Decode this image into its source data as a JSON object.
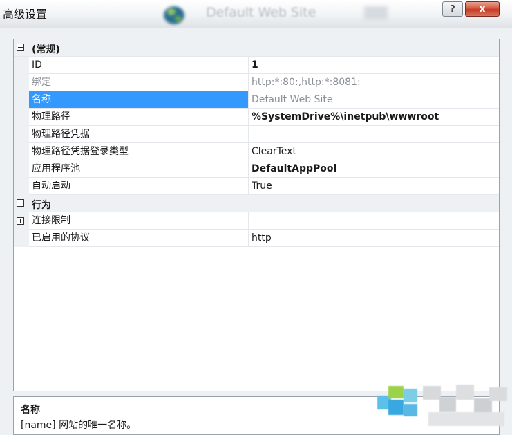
{
  "window": {
    "title": "高级设置",
    "site_name": "Default Web Site",
    "help_label": "?",
    "close_label": "x"
  },
  "categories": [
    {
      "label": "(常规)",
      "expanded": true
    },
    {
      "label": "行为",
      "expanded": true
    }
  ],
  "properties": {
    "general": [
      {
        "name": "ID",
        "value": "1",
        "bold": true
      },
      {
        "name": "绑定",
        "value": "http:*:80:,http:*:8081:",
        "disabled": true
      },
      {
        "name": "名称",
        "value": "Default Web Site",
        "selected": true
      },
      {
        "name": "物理路径",
        "value": "%SystemDrive%\\inetpub\\wwwroot",
        "bold": true
      },
      {
        "name": "物理路径凭据",
        "value": ""
      },
      {
        "name": "物理路径凭据登录类型",
        "value": "ClearText"
      },
      {
        "name": "应用程序池",
        "value": "DefaultAppPool",
        "bold": true
      },
      {
        "name": "自动启动",
        "value": "True"
      }
    ],
    "behavior": [
      {
        "name": "连接限制",
        "value": "",
        "expandable": true
      },
      {
        "name": "已启用的协议",
        "value": "http"
      }
    ]
  },
  "description": {
    "title": "名称",
    "text": "[name] 网站的唯一名称。"
  },
  "colors": {
    "selection": "#3399ff",
    "category_bg": "#eef1f4",
    "close_button": "#c94a33"
  },
  "icons": {
    "globe": "globe-icon",
    "help": "help-icon",
    "close": "close-icon",
    "collapse": "collapse-icon",
    "expand": "expand-icon"
  }
}
